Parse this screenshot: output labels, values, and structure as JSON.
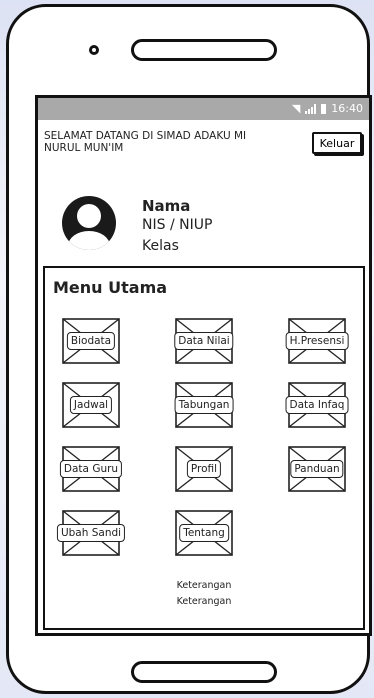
{
  "status_bar": {
    "time": "16:40"
  },
  "header": {
    "welcome_text": "SELAMAT DATANG DI SIMAD ADAKU MI NURUL MUN'IM",
    "logout_label": "Keluar"
  },
  "profile": {
    "name_label": "Nama",
    "id_label": "NIS / NIUP",
    "class_label": "Kelas"
  },
  "menu": {
    "title": "Menu Utama",
    "items": [
      {
        "label": "Biodata"
      },
      {
        "label": "Data Nilai"
      },
      {
        "label": "H.Presensi"
      },
      {
        "label": "Jadwal"
      },
      {
        "label": "Tabungan"
      },
      {
        "label": "Data Infaq"
      },
      {
        "label": "Data Guru"
      },
      {
        "label": "Profil"
      },
      {
        "label": "Panduan"
      },
      {
        "label": "Ubah Sandi"
      },
      {
        "label": "Tentang"
      }
    ],
    "notes": [
      "Keterangan",
      "Keterangan"
    ]
  }
}
